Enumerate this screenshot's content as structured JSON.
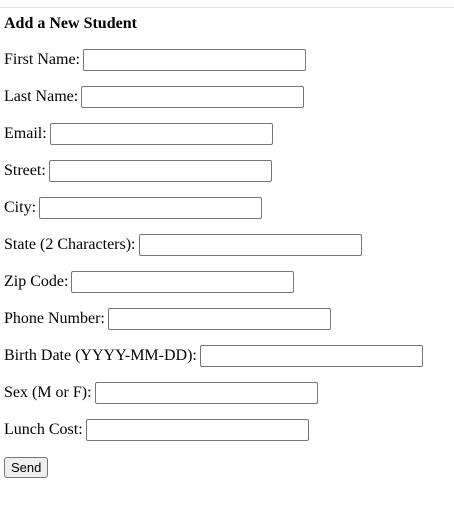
{
  "form": {
    "title": "Add a New Student",
    "fields": {
      "first_name": {
        "label": "First Name:",
        "value": ""
      },
      "last_name": {
        "label": "Last Name:",
        "value": ""
      },
      "email": {
        "label": "Email:",
        "value": ""
      },
      "street": {
        "label": "Street:",
        "value": ""
      },
      "city": {
        "label": "City:",
        "value": ""
      },
      "state": {
        "label": "State (2 Characters):",
        "value": ""
      },
      "zip": {
        "label": "Zip Code:",
        "value": ""
      },
      "phone": {
        "label": "Phone Number:",
        "value": ""
      },
      "birth_date": {
        "label": "Birth Date (YYYY-MM-DD):",
        "value": ""
      },
      "sex": {
        "label": "Sex (M or F):",
        "value": ""
      },
      "lunch_cost": {
        "label": "Lunch Cost:",
        "value": ""
      }
    },
    "submit_label": "Send"
  }
}
